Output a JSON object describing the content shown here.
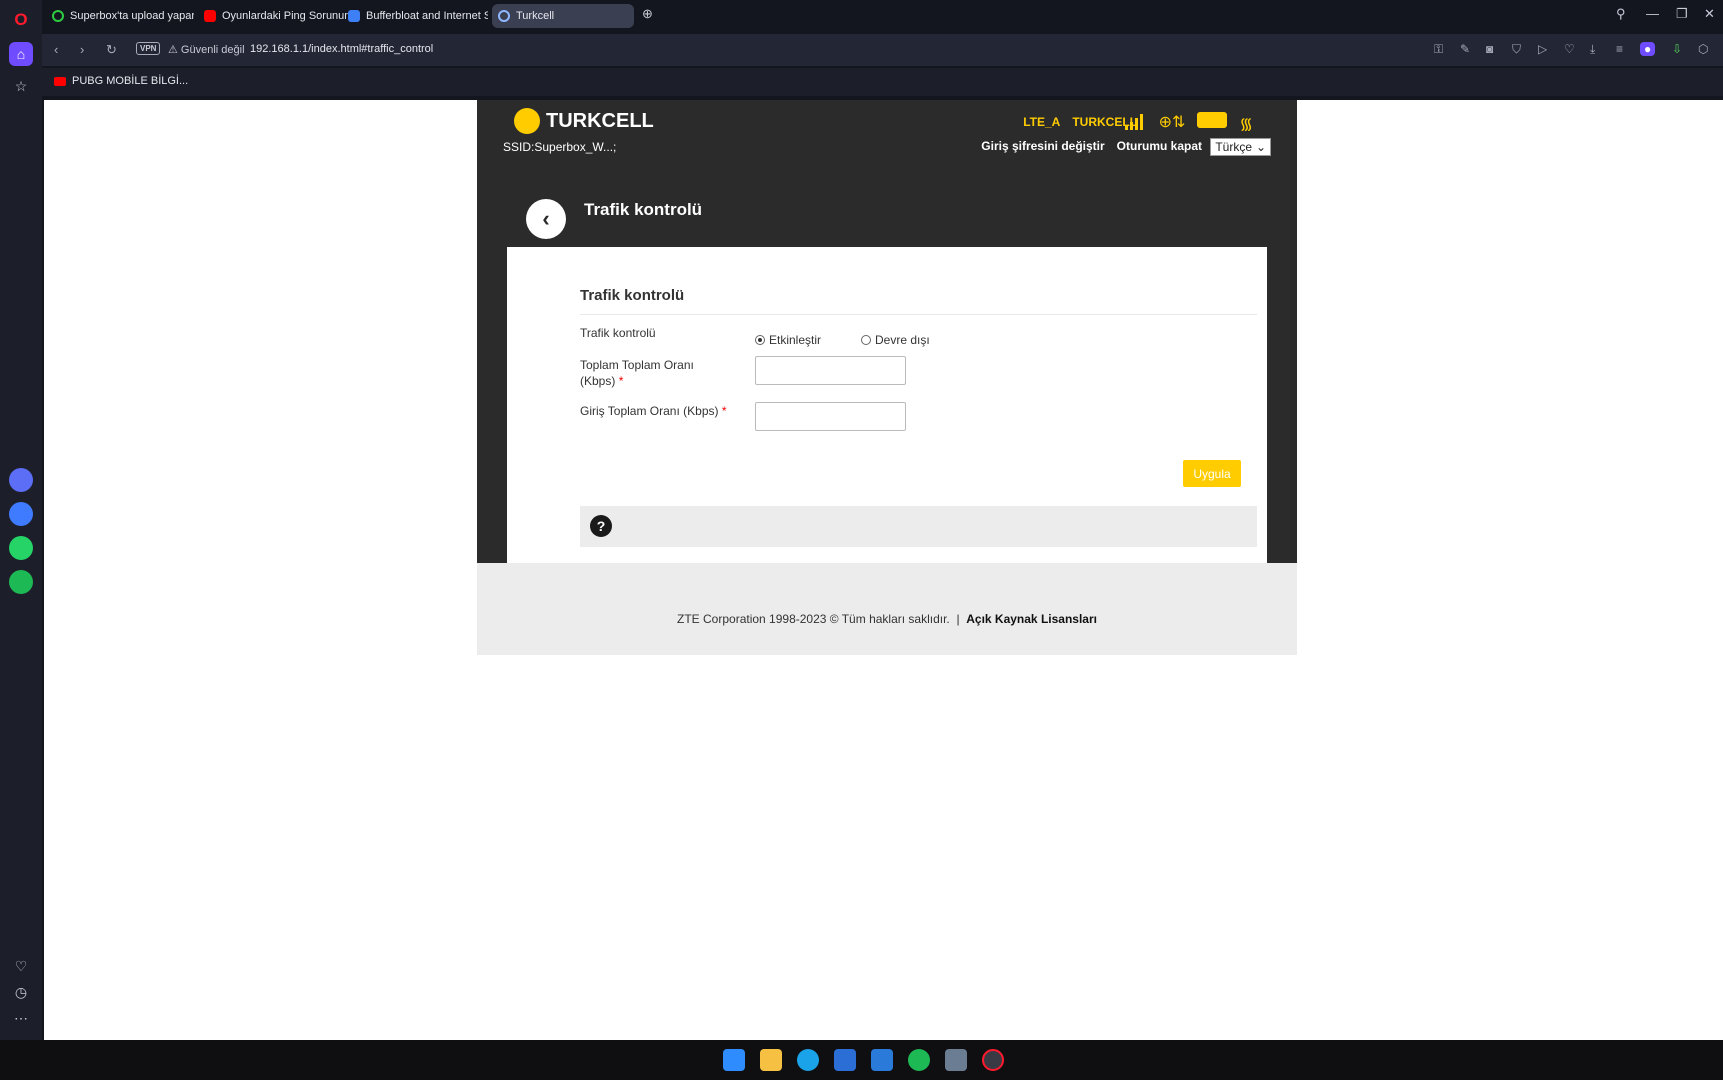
{
  "browser": {
    "tabs": [
      {
        "label": "Superbox'ta upload yapar...",
        "favicon": "power-icon",
        "favicon_color": "#2ecc40"
      },
      {
        "label": "Oyunlardaki Ping Sorunun...",
        "favicon": "youtube-icon",
        "favicon_color": "#ff0000"
      },
      {
        "label": "Bufferbloat and Internet S...",
        "favicon": "waveform-icon",
        "favicon_color": "#3d7ff5"
      },
      {
        "label": "Turkcell",
        "favicon": "globe-icon",
        "favicon_color": "#8fb8ff"
      }
    ],
    "address": {
      "vpn_label": "VPN",
      "security_text": "Güvenli değil",
      "url": "192.168.1.1/index.html#traffic_control"
    },
    "bookmarks": [
      {
        "label": "PUBG MOBİLE BİLGİ...",
        "icon": "youtube-icon"
      }
    ]
  },
  "router": {
    "brand": "TURKCELL",
    "ssid": "SSID:Superbox_W...;",
    "network_type": "LTE_A",
    "operator": "TURKCELL",
    "header_links": [
      "Giriş şifresini değiştir",
      "Oturumu kapat"
    ],
    "language": "Türkçe",
    "page_heading": "Trafik kontrolü",
    "section_title": "Trafik kontrolü",
    "form": {
      "traffic_label": "Trafik kontrolü",
      "enable_label": "Etkinleştir",
      "disable_label": "Devre dışı",
      "enabled": true,
      "total_rate_label": "Toplam Toplam Oranı",
      "total_rate_unit": "(Kbps)",
      "total_rate_value": "",
      "ingress_rate_label": "Giriş Toplam Oranı (Kbps)",
      "ingress_rate_value": "",
      "required_mark": "*",
      "apply_label": "Uygula"
    },
    "help_symbol": "?",
    "footer": {
      "copyright": "ZTE Corporation 1998-2023 © Tüm hakları saklıdır.",
      "separator": "|",
      "license_link": "Açık Kaynak Lisansları"
    },
    "accent_color": "#ffcc00"
  }
}
